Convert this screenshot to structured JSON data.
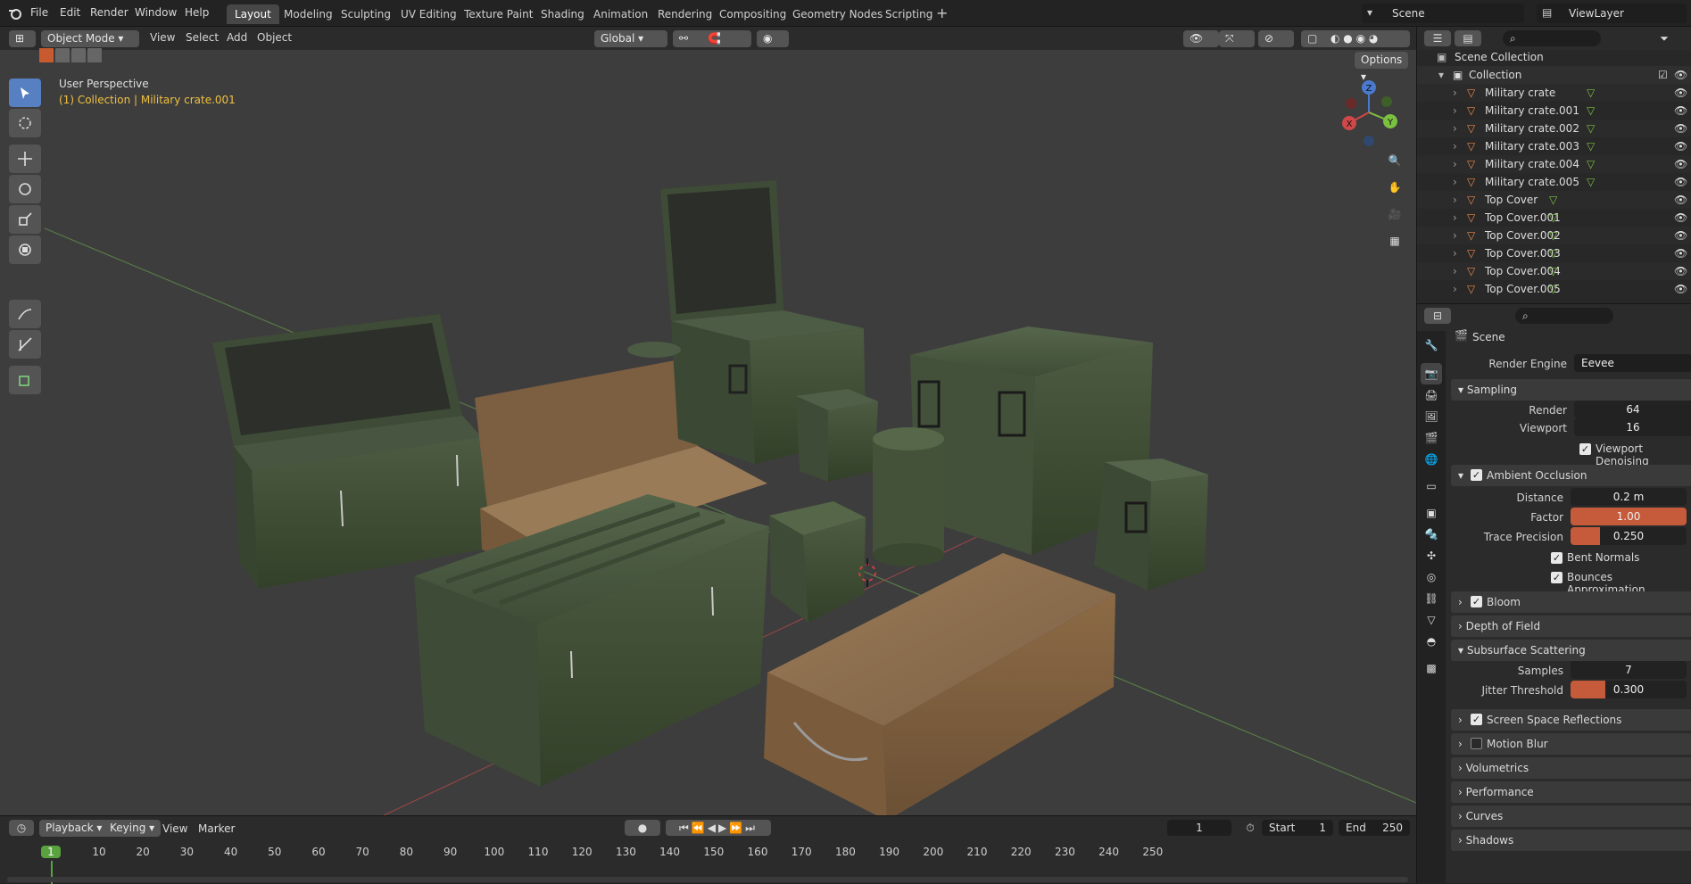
{
  "menu": {
    "file": "File",
    "edit": "Edit",
    "render": "Render",
    "window": "Window",
    "help": "Help"
  },
  "workspaces": [
    "Layout",
    "Modeling",
    "Sculpting",
    "UV Editing",
    "Texture Paint",
    "Shading",
    "Animation",
    "Rendering",
    "Compositing",
    "Geometry Nodes",
    "Scripting"
  ],
  "top_right": {
    "scene": "Scene",
    "view_layer": "ViewLayer"
  },
  "viewport": {
    "mode": "Object Mode",
    "view": "View",
    "select": "Select",
    "add": "Add",
    "object": "Object",
    "transform_orientation": "Global",
    "options": "Options",
    "perspective": "User Perspective",
    "active": "(1) Collection | Military crate.001",
    "gizmo": {
      "z": "Z",
      "y": "Y",
      "x": "X"
    }
  },
  "timeline": {
    "playback": "Playback",
    "keying": "Keying",
    "view": "View",
    "marker": "Marker",
    "current_frame": "1",
    "start_label": "Start",
    "start": "1",
    "end_label": "End",
    "end": "250",
    "ticks": [
      "1",
      "10",
      "20",
      "30",
      "40",
      "50",
      "60",
      "70",
      "80",
      "90",
      "100",
      "110",
      "120",
      "130",
      "140",
      "150",
      "160",
      "170",
      "180",
      "190",
      "200",
      "210",
      "220",
      "230",
      "240",
      "250"
    ]
  },
  "outliner": {
    "scene_collection": "Scene Collection",
    "collection": "Collection",
    "items": [
      "Military crate",
      "Military crate.001",
      "Military crate.002",
      "Military crate.003",
      "Military crate.004",
      "Military crate.005",
      "Top Cover",
      "Top Cover.001",
      "Top Cover.002",
      "Top Cover.003",
      "Top Cover.004",
      "Top Cover.005"
    ]
  },
  "properties": {
    "context": "Scene",
    "render_engine_label": "Render Engine",
    "render_engine": "Eevee",
    "sampling": {
      "title": "Sampling",
      "render_label": "Render",
      "render": "64",
      "viewport_label": "Viewport",
      "viewport": "16",
      "denoise": "Viewport Denoising"
    },
    "ao": {
      "title": "Ambient Occlusion",
      "distance_label": "Distance",
      "distance": "0.2 m",
      "factor_label": "Factor",
      "factor": "1.00",
      "factor_fill": 1.0,
      "trace_label": "Trace Precision",
      "trace": "0.250",
      "trace_fill": 0.25,
      "bent": "Bent Normals",
      "bounces": "Bounces Approximation"
    },
    "bloom": "Bloom",
    "dof": "Depth of Field",
    "sss": {
      "title": "Subsurface Scattering",
      "samples_label": "Samples",
      "samples": "7",
      "jitter_label": "Jitter Threshold",
      "jitter": "0.300",
      "jitter_fill": 0.3
    },
    "ssr": "Screen Space Reflections",
    "motion_blur": "Motion Blur",
    "volumetrics": "Volumetrics",
    "performance": "Performance",
    "curves": "Curves",
    "shadows": "Shadows"
  },
  "colors": {
    "accent": "#5680c2",
    "slider": "#c65b3b",
    "crate_green": "#4a5a40",
    "crate_wood": "#8a6a48"
  }
}
